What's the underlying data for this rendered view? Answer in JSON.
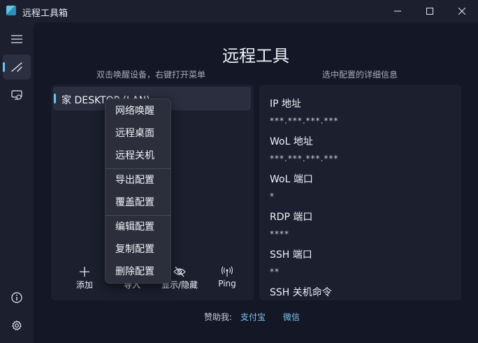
{
  "window": {
    "title": "远程工具箱"
  },
  "page": {
    "title": "远程工具",
    "left_subtitle": "双击唤醒设备，右键打开菜单",
    "right_subtitle": "选中配置的详细信息"
  },
  "devices": [
    {
      "label": "家 DESKTOP (LAN)"
    }
  ],
  "toolbar": {
    "add_label": "添加",
    "import_label": "导入",
    "toggle_label": "显示/隐藏",
    "ping_label": "Ping"
  },
  "details": [
    {
      "label": "IP 地址",
      "value": "***.***.***.***"
    },
    {
      "label": "WoL 地址",
      "value": "***.***.***.***"
    },
    {
      "label": "WoL 端口",
      "value": "*"
    },
    {
      "label": "RDP 端口",
      "value": "****"
    },
    {
      "label": "SSH 端口",
      "value": "**"
    },
    {
      "label": "SSH 关机命令",
      "value": ""
    }
  ],
  "context_menu": {
    "items": [
      "网络唤醒",
      "远程桌面",
      "远程关机",
      "导出配置",
      "覆盖配置",
      "编辑配置",
      "复制配置",
      "删除配置"
    ]
  },
  "sponsor": {
    "label": "赞助我:",
    "alipay": "支付宝",
    "wechat": "微信"
  },
  "colors": {
    "accent": "#60c8ef",
    "link": "#7cc8f0",
    "background": "#131726",
    "panel": "#1b1f2e"
  },
  "icons": {
    "sidebar": [
      "hamburger-icon",
      "remote-tools-icon",
      "remote-desktop-icon",
      "info-icon",
      "settings-icon"
    ],
    "toolbar": [
      "plus-icon",
      "import-icon",
      "eye-off-icon",
      "antenna-icon"
    ]
  }
}
